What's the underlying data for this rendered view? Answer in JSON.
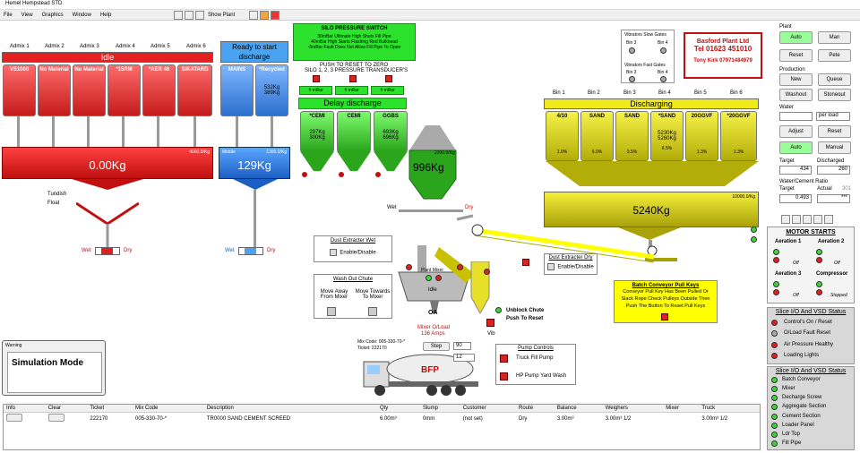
{
  "window": {
    "title": "Hemel Hempstead STD"
  },
  "menu": [
    "File",
    "View",
    "Graphics",
    "Window",
    "Help"
  ],
  "toolbar": {
    "show_plant": "Show Plant"
  },
  "admix": {
    "labels": [
      "Admix 1",
      "Admix 2",
      "Admix 3",
      "Admix 4",
      "Admix 5",
      "Admix 6"
    ],
    "status": "Idle",
    "bins": [
      "VS1000",
      "No Material",
      "No Material",
      "*15RM",
      "*AER 46",
      "SIKATARD"
    ],
    "weigher_value": "0.00Kg",
    "weigher_cap": "4000.0/Kg",
    "tundish": "Tundish",
    "float": "Float",
    "wet": "Wet",
    "dry": "Dry"
  },
  "water": {
    "status": "Ready to start discharge",
    "bins": [
      "MAINS",
      "*Recycled"
    ],
    "weights": [
      "532Kg",
      "389Kg"
    ],
    "weigher_label": "Middle",
    "weigher_value": "129Kg",
    "weigher_cap": "1300.0/Kg",
    "wet": "Wet",
    "dry": "Dry"
  },
  "silo_switch": {
    "title": "SILO PRESSURE SWITCH",
    "lines": [
      "30mBar Ultimate High Shuts Fill Pipe",
      "40mBar High Starts Flashing Red Bulkhead",
      "-5mBar Fault Does Not Allow Fill Pipe To Open"
    ]
  },
  "transducers": {
    "title": "PUSH TO RESET TO ZERO",
    "subtitle": "SILO 1, 2, 3 PRESSURE TRANSDUCER'S",
    "readings": [
      "# mBar",
      "# mBar",
      "# mBar"
    ]
  },
  "cement": {
    "status": "Delay discharge",
    "bins": [
      "*CEMI",
      "CEMI",
      "GGBS"
    ],
    "weights_a": [
      "297Kg",
      "300Kg"
    ],
    "weights_b": [
      "693Kg",
      "696Kg"
    ],
    "weigher_value": "996Kg",
    "weigher_cap": "2200.0/Kg"
  },
  "aggregate": {
    "labels": [
      "Bin 1",
      "Bin 2",
      "Bin 3",
      "Bin 4",
      "Bin 5",
      "Bin 6"
    ],
    "status": "Discharging",
    "bins": [
      "4/10",
      "SAND",
      "SAND",
      "*SAND",
      "20GGVF",
      "*20GGVF"
    ],
    "moisture": [
      "1.0%",
      "6.0%",
      "3.5%",
      "6.5%",
      "1.3%",
      "1.3%"
    ],
    "weights": [
      "5230Kg",
      "5260Kg"
    ],
    "weigher_value": "5240Kg",
    "weigher_cap": "10000.0/Kg"
  },
  "vibrators": {
    "slow_title": "Vibrators Slow Gates",
    "fast_title": "Vibrators Fast Gates",
    "bins": [
      "Bin 3",
      "Bin 4"
    ]
  },
  "company": {
    "name": "Basford Plant Ltd",
    "tel": "Tel 01623 451010",
    "contact": "Tony Kirk 07971484979"
  },
  "plant_panel": {
    "plant": "Plant",
    "auto": "Auto",
    "man": "Man",
    "reset": "Reset",
    "pete": "Pete",
    "production": "Production",
    "new": "New",
    "queue": "Queue",
    "washout": "Washout",
    "stoneout": "Stoneout",
    "water": "Water",
    "per_load": "per load",
    "adjust": "Adjust",
    "reset2": "Reset",
    "auto2": "Auto",
    "manual": "Manual",
    "target": "Target",
    "discharged": "Discharged",
    "target_val": "434",
    "discharged_val": "260",
    "wc_ratio": "Water/Cement Ratio",
    "wc_target": "Target",
    "wc_actual": "Actual",
    "wc_actual_hint": "301",
    "wc_target_val": "0.493",
    "wc_actual_val": "***"
  },
  "motors": {
    "title": "MOTOR STARTS",
    "items": [
      "Aeration 1",
      "Aeration 2",
      "Aeration 3",
      "Compressor"
    ],
    "states": [
      "Off",
      "Off",
      "Off",
      "Stopped"
    ]
  },
  "slice1": {
    "title": "Slice I/O And VSD Status",
    "items": [
      "Control's On / Reset",
      "O/Load Fault Reset",
      "Air Pressure Healthy",
      "Loading Lights"
    ]
  },
  "slice2": {
    "title": "Slice I/O And VSD Status",
    "items": [
      "Batch Conveyor",
      "Mixer",
      "Decharge Screw",
      "Aggregate Section",
      "Cement Section",
      "Loader Panel",
      "Ldr Top",
      "Fill Pipe"
    ]
  },
  "dust_wet": {
    "title": "Dust Extracter Wet",
    "label": "Enable/Disable"
  },
  "dust_dry": {
    "title": "Dust Extracter Dry",
    "label": "Enable/Disable"
  },
  "washout_chute": {
    "title": "Wash Out Chute",
    "left": "Move Away From Mixer",
    "right": "Move Towards To Mixer"
  },
  "conveyor_keys": {
    "title": "Batch Conveyor Pull Keys",
    "text": "Conveyor Pull Key Has Been Pulled Or Slack Rope Check Pulleys Outside Then Push The Button To Reset Pull Keys"
  },
  "mixer": {
    "title": "Plant Mixer",
    "state": "Idle",
    "oa": "OA",
    "overload": "Mixer O/Load",
    "amps": "136 Amps",
    "wet": "Wet",
    "dry": "Dry",
    "vib": "Vib",
    "unblock": "Unblock Chute",
    "unblock2": "Push To Reset"
  },
  "truck": {
    "mix_code": "Mix Code: 005-330-70-*",
    "ticket": "Ticket: 222170",
    "step": "Step",
    "val1": "90",
    "val2": "12"
  },
  "pump": {
    "title": "Pump Controls",
    "truck_fill": "Truck Fill Pump",
    "hp_pump": "HP Pump Yard Wash"
  },
  "warning": {
    "title": "Warning",
    "text": "Simulation Mode"
  },
  "table": {
    "headers": [
      "Info",
      "Clear",
      "Ticket",
      "Mix Code",
      "Description",
      "Qty",
      "Slump",
      "Customer",
      "Route",
      "Balance",
      "Weighers",
      "Mixer",
      "Truck"
    ],
    "row": [
      "",
      "",
      "222170",
      "005-330-70-*",
      "TR0000 SAND CEMENT SCREED",
      "6.00m³",
      "0mm",
      "(not set)",
      "Dry",
      "3.00m³",
      "3.00m³ 1/2",
      "",
      "3.00m³ 1/2"
    ]
  }
}
